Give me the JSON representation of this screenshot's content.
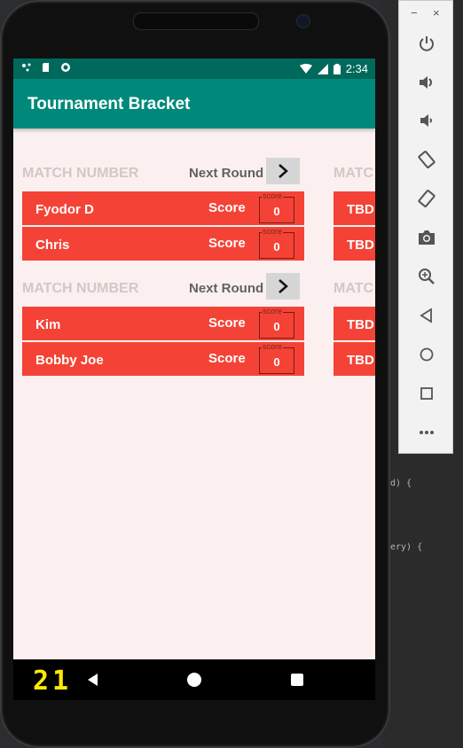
{
  "status_bar": {
    "time": "2:34"
  },
  "app": {
    "title": "Tournament Bracket"
  },
  "round1": {
    "matches": [
      {
        "label": "MATCH NUMBER",
        "next_label": "Next Round",
        "players": [
          {
            "name": "Fyodor D",
            "score_label": "Score",
            "score_caption": "score",
            "score": "0"
          },
          {
            "name": "Chris",
            "score_label": "Score",
            "score_caption": "score",
            "score": "0"
          }
        ]
      },
      {
        "label": "MATCH NUMBER",
        "next_label": "Next Round",
        "players": [
          {
            "name": "Kim",
            "score_label": "Score",
            "score_caption": "score",
            "score": "0"
          },
          {
            "name": "Bobby Joe",
            "score_label": "Score",
            "score_caption": "score",
            "score": "0"
          }
        ]
      }
    ]
  },
  "round2": {
    "matches": [
      {
        "label": "MATC",
        "players": [
          {
            "name": "TBD"
          },
          {
            "name": "TBD"
          }
        ]
      },
      {
        "label": "MATC",
        "players": [
          {
            "name": "TBD"
          },
          {
            "name": "TBD"
          }
        ]
      }
    ]
  },
  "nav": {
    "fps_counter": "21"
  },
  "toolbar": {
    "minimize": "−",
    "close": "×"
  },
  "ide": {
    "code_line_1": "d) {",
    "code_line_2": "ery) {"
  },
  "colors": {
    "status_bar": "#00695c",
    "app_bar": "#00897b",
    "screen_bg": "#fbf0ef",
    "player_row": "#f44336",
    "next_button": "#d6d6d6",
    "fps": "#ffea00"
  }
}
